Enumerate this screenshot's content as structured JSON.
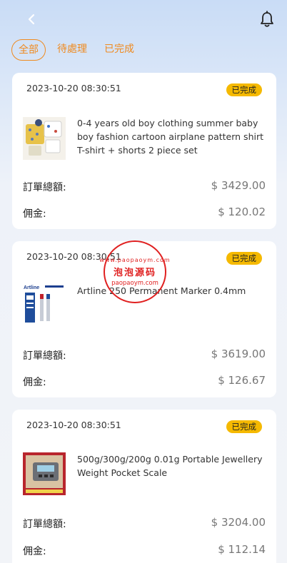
{
  "header": {
    "back_icon": "chevron-left-icon",
    "bell_icon": "bell-icon"
  },
  "tabs": [
    {
      "label": "全部",
      "active": true
    },
    {
      "label": "待處理",
      "active": false
    },
    {
      "label": "已完成",
      "active": false
    }
  ],
  "labels": {
    "total": "訂單總額:",
    "commission": "佣金:"
  },
  "orders": [
    {
      "time": "2023-10-20 08:30:51",
      "status": "已完成",
      "product": "0-4 years old boy clothing summer baby boy fashion cartoon airplane pattern shirt T-shirt + shorts 2 piece set",
      "total": "$ 3429.00",
      "commission": "$ 120.02"
    },
    {
      "time": "2023-10-20 08:30:51",
      "status": "已完成",
      "product": "Artline 250 Permanent Marker 0.4mm",
      "total": "$ 3619.00",
      "commission": "$ 126.67"
    },
    {
      "time": "2023-10-20 08:30:51",
      "status": "已完成",
      "product": "500g/300g/200g 0.01g Portable Jewellery Weight Pocket Scale",
      "total": "$ 3204.00",
      "commission": "$ 112.14"
    }
  ],
  "watermark": {
    "top": "www.paopaoym.com",
    "middle": "泡泡源码",
    "bottom": "paopaoym.com"
  },
  "colors": {
    "accent": "#ef8a1f",
    "badge": "#f5b900",
    "stamp": "#e02020"
  }
}
